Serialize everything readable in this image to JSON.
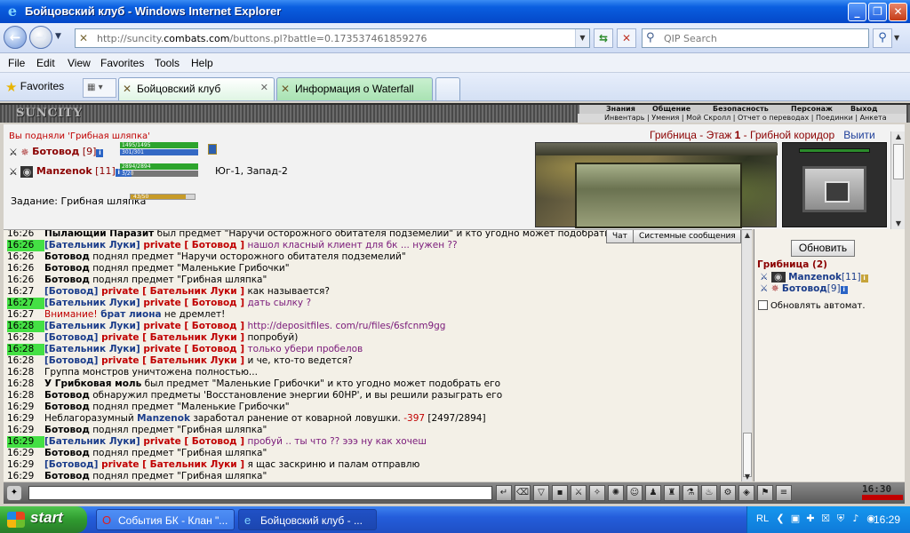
{
  "window": {
    "title": "Бойцовский клуб - Windows Internet Explorer",
    "min": "_",
    "max": "❐",
    "close": "✕"
  },
  "nav": {
    "url_prefix": "http://suncity.",
    "url_domain": "combats.com",
    "url_suffix": "/buttons.pl?battle=0.173537461859276",
    "search_placeholder": "QIP Search"
  },
  "menu": [
    "File",
    "Edit",
    "View",
    "Favorites",
    "Tools",
    "Help"
  ],
  "tabs": {
    "favorites_label": "Favorites",
    "items": [
      {
        "label": "Бойцовский клуб"
      },
      {
        "label": "Информация о Waterfall"
      }
    ]
  },
  "game": {
    "logo": "SUNCITY",
    "top_links": [
      "Знания",
      "Общение",
      "Безопасность",
      "Персонаж",
      "Выход"
    ],
    "sub_links": "Инвентарь | Умения | Мой Скролл | Отчет о переводах | Поединки | Анкета",
    "raised_notice": "Вы подняли 'Грибная шляпка'",
    "chars": [
      {
        "name": "Ботовод",
        "level": "[9]",
        "hp": "1495/1495",
        "mp": "301/301",
        "hp_frac": 1.0,
        "mp_frac": 1.0
      },
      {
        "name": "Manzenok",
        "level": "[11]",
        "hp": "2894/2894",
        "mp": "3/20",
        "hp_frac": 1.0,
        "mp_frac": 0.15
      }
    ],
    "coords": "Юг-1, Запад-2",
    "task_label": "Задание: Грибная шляпка",
    "task_progress": "43/50",
    "task_frac": 0.86,
    "location_prefix": "Грибница - Этаж ",
    "location_floor": "1",
    "location_suffix": " - Грибной коридор",
    "exit": "Выити"
  },
  "chat": {
    "tabs": [
      "Чат",
      "Системные сообщения"
    ],
    "lines": [
      {
        "t": "16:26",
        "hl": false,
        "parts": [
          [
            "b",
            "Пылающий Паразит"
          ],
          [
            "",
            " был предмет \"Наручи осторожного обитателя подземелий\" и кто угодно может подобрать его"
          ]
        ]
      },
      {
        "t": "16:26",
        "hl": true,
        "parts": [
          [
            "u",
            "[Бательник Луки]"
          ],
          [
            "p",
            " private [ Ботовод ]"
          ],
          [
            "m",
            " нашол класный клиент для бк ... нужен ??"
          ]
        ]
      },
      {
        "t": "16:26",
        "hl": false,
        "parts": [
          [
            "b",
            "Ботовод"
          ],
          [
            "",
            " поднял предмет \"Наручи осторожного обитателя подземелий\""
          ]
        ]
      },
      {
        "t": "16:26",
        "hl": false,
        "parts": [
          [
            "b",
            "Ботовод"
          ],
          [
            "",
            " поднял предмет \"Маленькие Грибочки\""
          ]
        ]
      },
      {
        "t": "16:26",
        "hl": false,
        "parts": [
          [
            "b",
            "Ботовод"
          ],
          [
            "",
            " поднял предмет \"Грибная шляпка\""
          ]
        ]
      },
      {
        "t": "16:27",
        "hl": false,
        "parts": [
          [
            "u",
            "[Ботовод]"
          ],
          [
            "p",
            " private [ Бательник Луки ]"
          ],
          [
            "",
            " как называется?"
          ]
        ]
      },
      {
        "t": "16:27",
        "hl": true,
        "parts": [
          [
            "u",
            "[Бательник Луки]"
          ],
          [
            "p",
            " private [ Ботовод ]"
          ],
          [
            "m",
            " дать сылку ?"
          ]
        ]
      },
      {
        "t": "16:27",
        "hl": false,
        "parts": [
          [
            "red",
            "Внимание!"
          ],
          [
            "blue",
            " брат лиона"
          ],
          [
            "",
            " не дремлет!"
          ]
        ]
      },
      {
        "t": "16:28",
        "hl": true,
        "parts": [
          [
            "u",
            "[Бательник Луки]"
          ],
          [
            "p",
            " private [ Ботовод ]"
          ],
          [
            "m",
            " http://depositfiles. com/ru/files/6sfcnm9gg"
          ]
        ]
      },
      {
        "t": "16:28",
        "hl": false,
        "parts": [
          [
            "u",
            "[Ботовод]"
          ],
          [
            "p",
            " private [ Бательник Луки ]"
          ],
          [
            "",
            " попробуй)"
          ]
        ]
      },
      {
        "t": "16:28",
        "hl": true,
        "parts": [
          [
            "u",
            "[Бательник Луки]"
          ],
          [
            "p",
            " private [ Ботовод ]"
          ],
          [
            "m",
            " только убери пробелов"
          ]
        ]
      },
      {
        "t": "16:28",
        "hl": false,
        "parts": [
          [
            "u",
            "[Ботовод]"
          ],
          [
            "p",
            " private [ Бательник Луки ]"
          ],
          [
            "",
            " и че, кто-то ведется?"
          ]
        ]
      },
      {
        "t": "16:28",
        "hl": false,
        "parts": [
          [
            "",
            "Группа монстров уничтожена полностью..."
          ]
        ]
      },
      {
        "t": "16:28",
        "hl": false,
        "parts": [
          [
            "b",
            "У Грибковая моль"
          ],
          [
            "",
            " был предмет \"Маленькие Грибочки\" и кто угодно может подобрать его"
          ]
        ]
      },
      {
        "t": "16:28",
        "hl": false,
        "parts": [
          [
            "b",
            "Ботовод"
          ],
          [
            "",
            " обнаружил предметы 'Восстановление энергии 60HP', и вы решили разыграть его"
          ]
        ]
      },
      {
        "t": "16:29",
        "hl": false,
        "parts": [
          [
            "b",
            "Ботовод"
          ],
          [
            "",
            " поднял предмет \"Маленькие Грибочки\""
          ]
        ]
      },
      {
        "t": "16:29",
        "hl": false,
        "parts": [
          [
            "",
            "Неблагоразумный "
          ],
          [
            "blue",
            "Manzenok"
          ],
          [
            "",
            " заработал ранение от коварной ловушки. "
          ],
          [
            "red",
            "-397"
          ],
          [
            "",
            " [2497/2894]"
          ]
        ]
      },
      {
        "t": "16:29",
        "hl": false,
        "parts": [
          [
            "b",
            "Ботовод"
          ],
          [
            "",
            " поднял предмет \"Грибная шляпка\""
          ]
        ]
      },
      {
        "t": "16:29",
        "hl": true,
        "parts": [
          [
            "u",
            "[Бательник Луки]"
          ],
          [
            "p",
            " private [ Ботовод ]"
          ],
          [
            "m",
            " пробуй .. ты что ?? эээ ну как хочеш"
          ]
        ]
      },
      {
        "t": "16:29",
        "hl": false,
        "parts": [
          [
            "b",
            "Ботовод"
          ],
          [
            "",
            " поднял предмет \"Грибная шляпка\""
          ]
        ]
      },
      {
        "t": "16:29",
        "hl": false,
        "parts": [
          [
            "u",
            "[Ботовод]"
          ],
          [
            "p",
            " private [ Бательник Луки ]"
          ],
          [
            "",
            " я щас заскриню и палам отправлю"
          ]
        ]
      },
      {
        "t": "16:29",
        "hl": false,
        "parts": [
          [
            "b",
            "Ботовод"
          ],
          [
            "",
            " поднял предмет \"Грибная шляпка\""
          ]
        ]
      }
    ]
  },
  "panel": {
    "refresh": "Обновить",
    "room_title": "Грибница (2)",
    "users": [
      {
        "name": "Manzenok",
        "level": "[11]"
      },
      {
        "name": "Ботовод",
        "level": "[9]"
      }
    ],
    "auto_refresh": "Обновлять автомат."
  },
  "input": {
    "clock": "16:30"
  },
  "taskbar": {
    "start": "start",
    "items": [
      "События БК - Клан \"...",
      "Бойцовский клуб - ..."
    ],
    "lang": "RL",
    "time": "16:29"
  }
}
